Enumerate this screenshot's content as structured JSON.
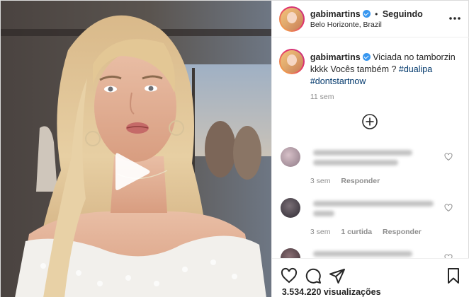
{
  "header": {
    "username": "gabimartins",
    "separator": "•",
    "follow_status": "Seguindo",
    "location": "Belo Horizonte, Brazil"
  },
  "caption": {
    "username": "gabimartins",
    "text": "Viciada no tamborzin kkkk Vocês também ?",
    "hashtags": [
      "#dualipa",
      "#dontstartnow"
    ],
    "time": "11 sem"
  },
  "comments": [
    {
      "time": "3 sem",
      "likes": "",
      "reply_label": "Responder"
    },
    {
      "time": "3 sem",
      "likes": "1 curtida",
      "reply_label": "Responder"
    }
  ],
  "stats": {
    "views": "3.534.220 visualizações"
  },
  "icons": {
    "verified": "verified-badge-icon",
    "more": "more-options-icon",
    "load_more": "load-more-comments-icon",
    "like": "heart-icon",
    "comment": "comment-icon",
    "share": "share-icon",
    "save": "bookmark-icon",
    "play": "play-icon"
  },
  "colors": {
    "verified": "#3897f0",
    "hashtag": "#00376b",
    "muted": "#8e8e8e",
    "text": "#262626"
  }
}
